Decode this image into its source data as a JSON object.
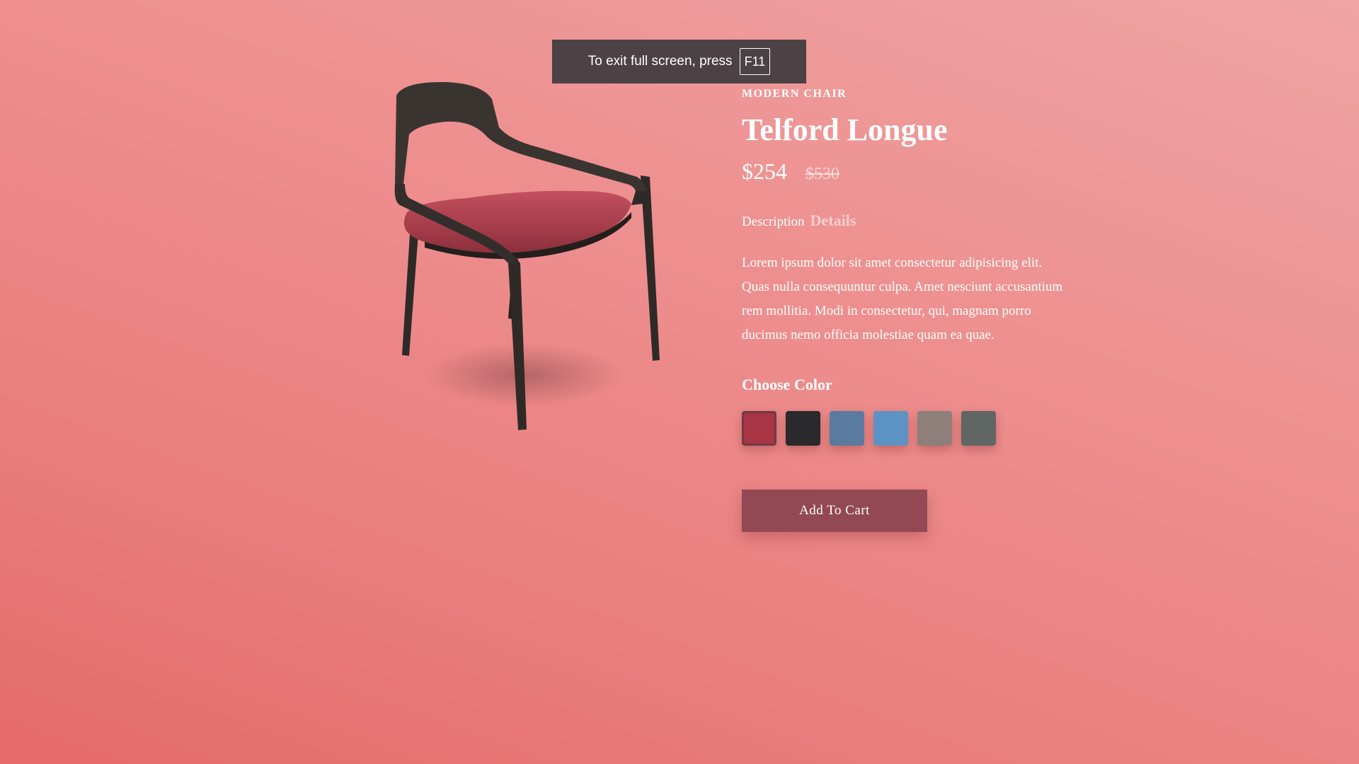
{
  "fullscreen_notice": {
    "text": "To exit full screen, press",
    "key": "F11"
  },
  "product": {
    "image_icon": "chair-image",
    "category": "Modern Chair",
    "name": "Telford Longue",
    "price": "$254",
    "old_price": "$530",
    "tabs": {
      "description": "Description",
      "details": "Details"
    },
    "description": "Lorem ipsum dolor sit amet consectetur adipisicing elit. Quas nulla consequuntur culpa. Amet nesciunt accusantium rem mollitia. Modi in consectetur, qui, magnam porro ducimus nemo officia molestiae quam ea quae.",
    "choose_color_label": "Choose Color",
    "colors": [
      {
        "name": "crimson",
        "hex": "#a83444",
        "selected": true
      },
      {
        "name": "black",
        "hex": "#2a2a2e",
        "selected": false
      },
      {
        "name": "denim-blue",
        "hex": "#5a7aa0",
        "selected": false
      },
      {
        "name": "sky-blue",
        "hex": "#5c93c4",
        "selected": false
      },
      {
        "name": "taupe",
        "hex": "#8e7f7a",
        "selected": false
      },
      {
        "name": "slate-gray",
        "hex": "#5f6663",
        "selected": false
      }
    ],
    "add_to_cart_label": "Add To Cart"
  },
  "colors": {
    "background_top": "#f0a4a4",
    "background_bottom": "#e56a6a",
    "button": "#924954"
  }
}
